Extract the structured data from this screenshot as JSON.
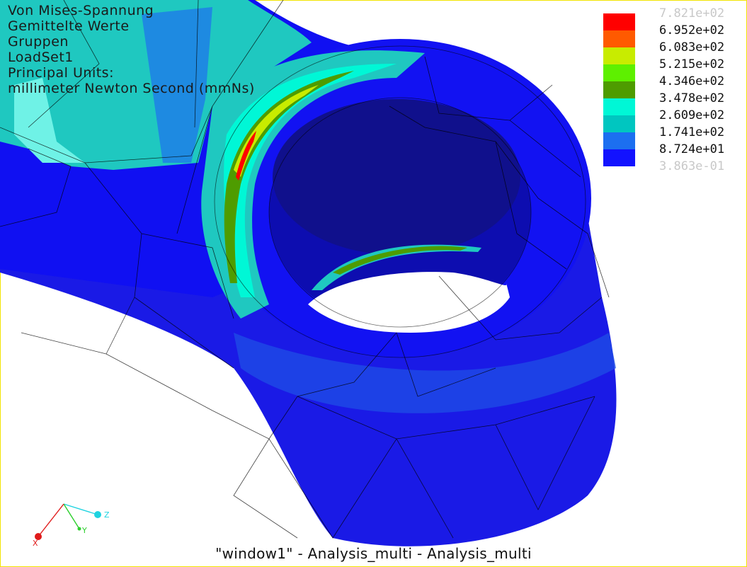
{
  "result_info": {
    "lines": [
      "Von Mises-Spannung",
      "Gemittelte Werte",
      "Gruppen",
      "LoadSet1",
      "Principal Units:",
      "millimeter Newton Second (mmNs)"
    ]
  },
  "legend": {
    "labels": [
      "7.821e+02",
      "6.952e+02",
      "6.083e+02",
      "5.215e+02",
      "4.346e+02",
      "3.478e+02",
      "2.609e+02",
      "1.741e+02",
      "8.724e+01",
      "3.863e-01"
    ],
    "colors": [
      "#ff0000",
      "#ff5a00",
      "#c8ec00",
      "#5ef000",
      "#4e9c00",
      "#00f7d6",
      "#00c6c0",
      "#1c6ff0",
      "#1212ff"
    ]
  },
  "window_caption": "\"window1\" - Analysis_multi - Analysis_multi",
  "triad": {
    "x_label": "X",
    "y_label": "Y",
    "z_label": "Z"
  }
}
